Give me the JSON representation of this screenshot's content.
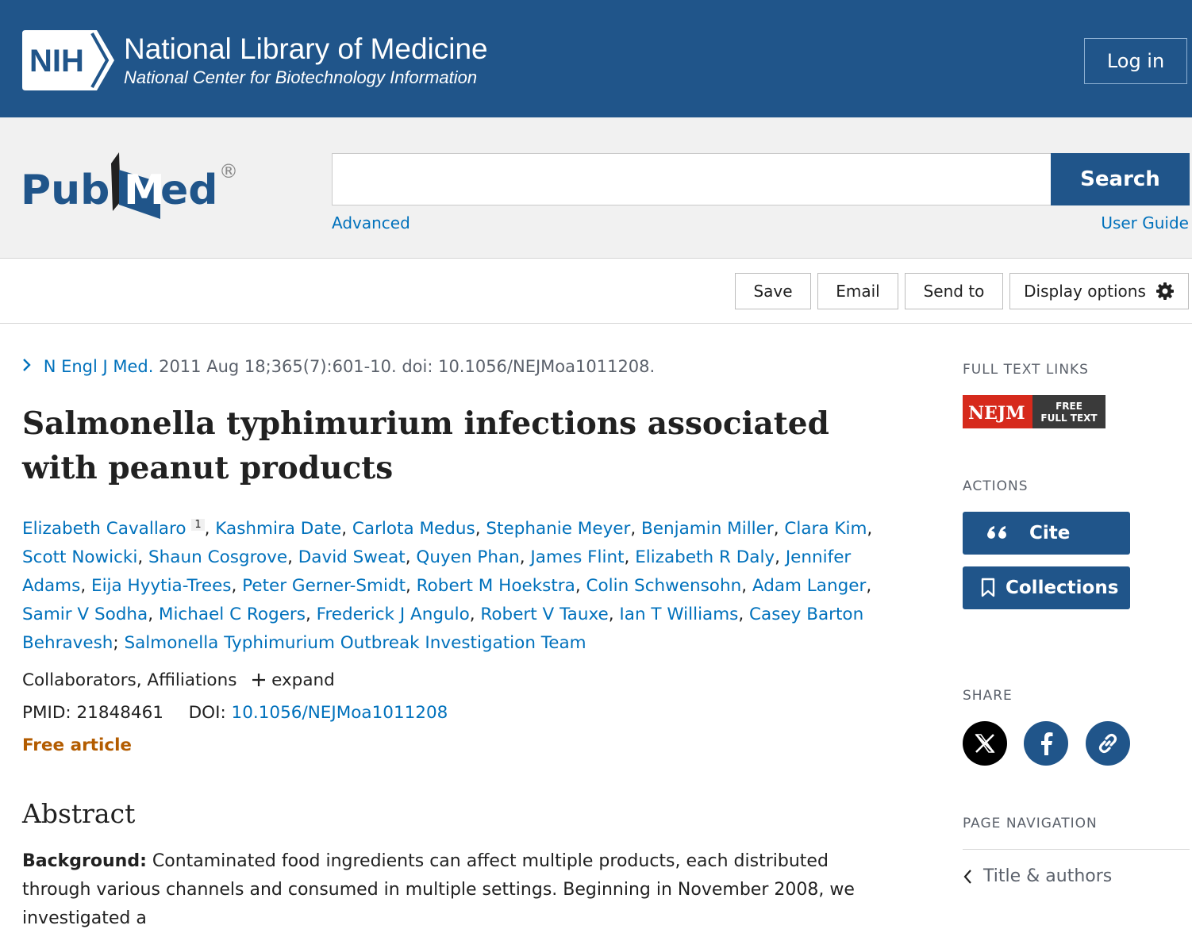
{
  "header": {
    "logo_text": "NIH",
    "org_title": "National Library of Medicine",
    "org_subtitle": "National Center for Biotechnology Information",
    "login_label": "Log in",
    "brand_color": "#20558a"
  },
  "search": {
    "logo_text": "PubMed",
    "logo_mark": "®",
    "query": "",
    "button_label": "Search",
    "advanced_label": "Advanced",
    "user_guide_label": "User Guide"
  },
  "toolbar": {
    "save_label": "Save",
    "email_label": "Email",
    "send_to_label": "Send to",
    "display_options_label": "Display options",
    "display_options_icon": "gear-icon"
  },
  "article": {
    "journal": "N Engl J Med.",
    "citation_rest": " 2011 Aug 18;365(7):601-10. doi: 10.1056/NEJMoa1011208.",
    "title": "Salmonella typhimurium infections associated with peanut products",
    "authors": [
      "Elizabeth Cavallaro",
      "Kashmira Date",
      "Carlota Medus",
      "Stephanie Meyer",
      "Benjamin Miller",
      "Clara Kim",
      "Scott Nowicki",
      "Shaun Cosgrove",
      "David Sweat",
      "Quyen Phan",
      "James Flint",
      "Elizabeth R Daly",
      "Jennifer Adams",
      "Eija Hyytia-Trees",
      "Peter Gerner-Smidt",
      "Robert M Hoekstra",
      "Colin Schwensohn",
      "Adam Langer",
      "Samir V Sodha",
      "Michael C Rogers",
      "Frederick J Angulo",
      "Robert V Tauxe",
      "Ian T Williams",
      "Casey Barton Behravesh"
    ],
    "first_author_affiliation": "1",
    "group_author": "Salmonella Typhimurium Outbreak Investigation Team",
    "collaborators_label": "Collaborators, Affiliations",
    "expand_label": "expand",
    "pmid_label": "PMID:",
    "pmid": "21848461",
    "doi_label": "DOI:",
    "doi": "10.1056/NEJMoa1011208",
    "free_label": "Free article",
    "abstract_heading": "Abstract",
    "abstract_bg_label": "Background:",
    "abstract_bg_text": " Contaminated food ingredients can affect multiple products, each distributed through various channels and consumed in multiple settings. Beginning in November 2008, we investigated a"
  },
  "sidebar": {
    "full_text_heading": "FULL TEXT LINKS",
    "nejm_logo": "NEJM",
    "nejm_free_line1": "FREE",
    "nejm_free_line2": "FULL TEXT",
    "actions_heading": "ACTIONS",
    "cite_label": "Cite",
    "collections_label": "Collections",
    "share_heading": "SHARE",
    "page_nav_heading": "PAGE NAVIGATION",
    "nav_first_item": "Title & authors"
  }
}
